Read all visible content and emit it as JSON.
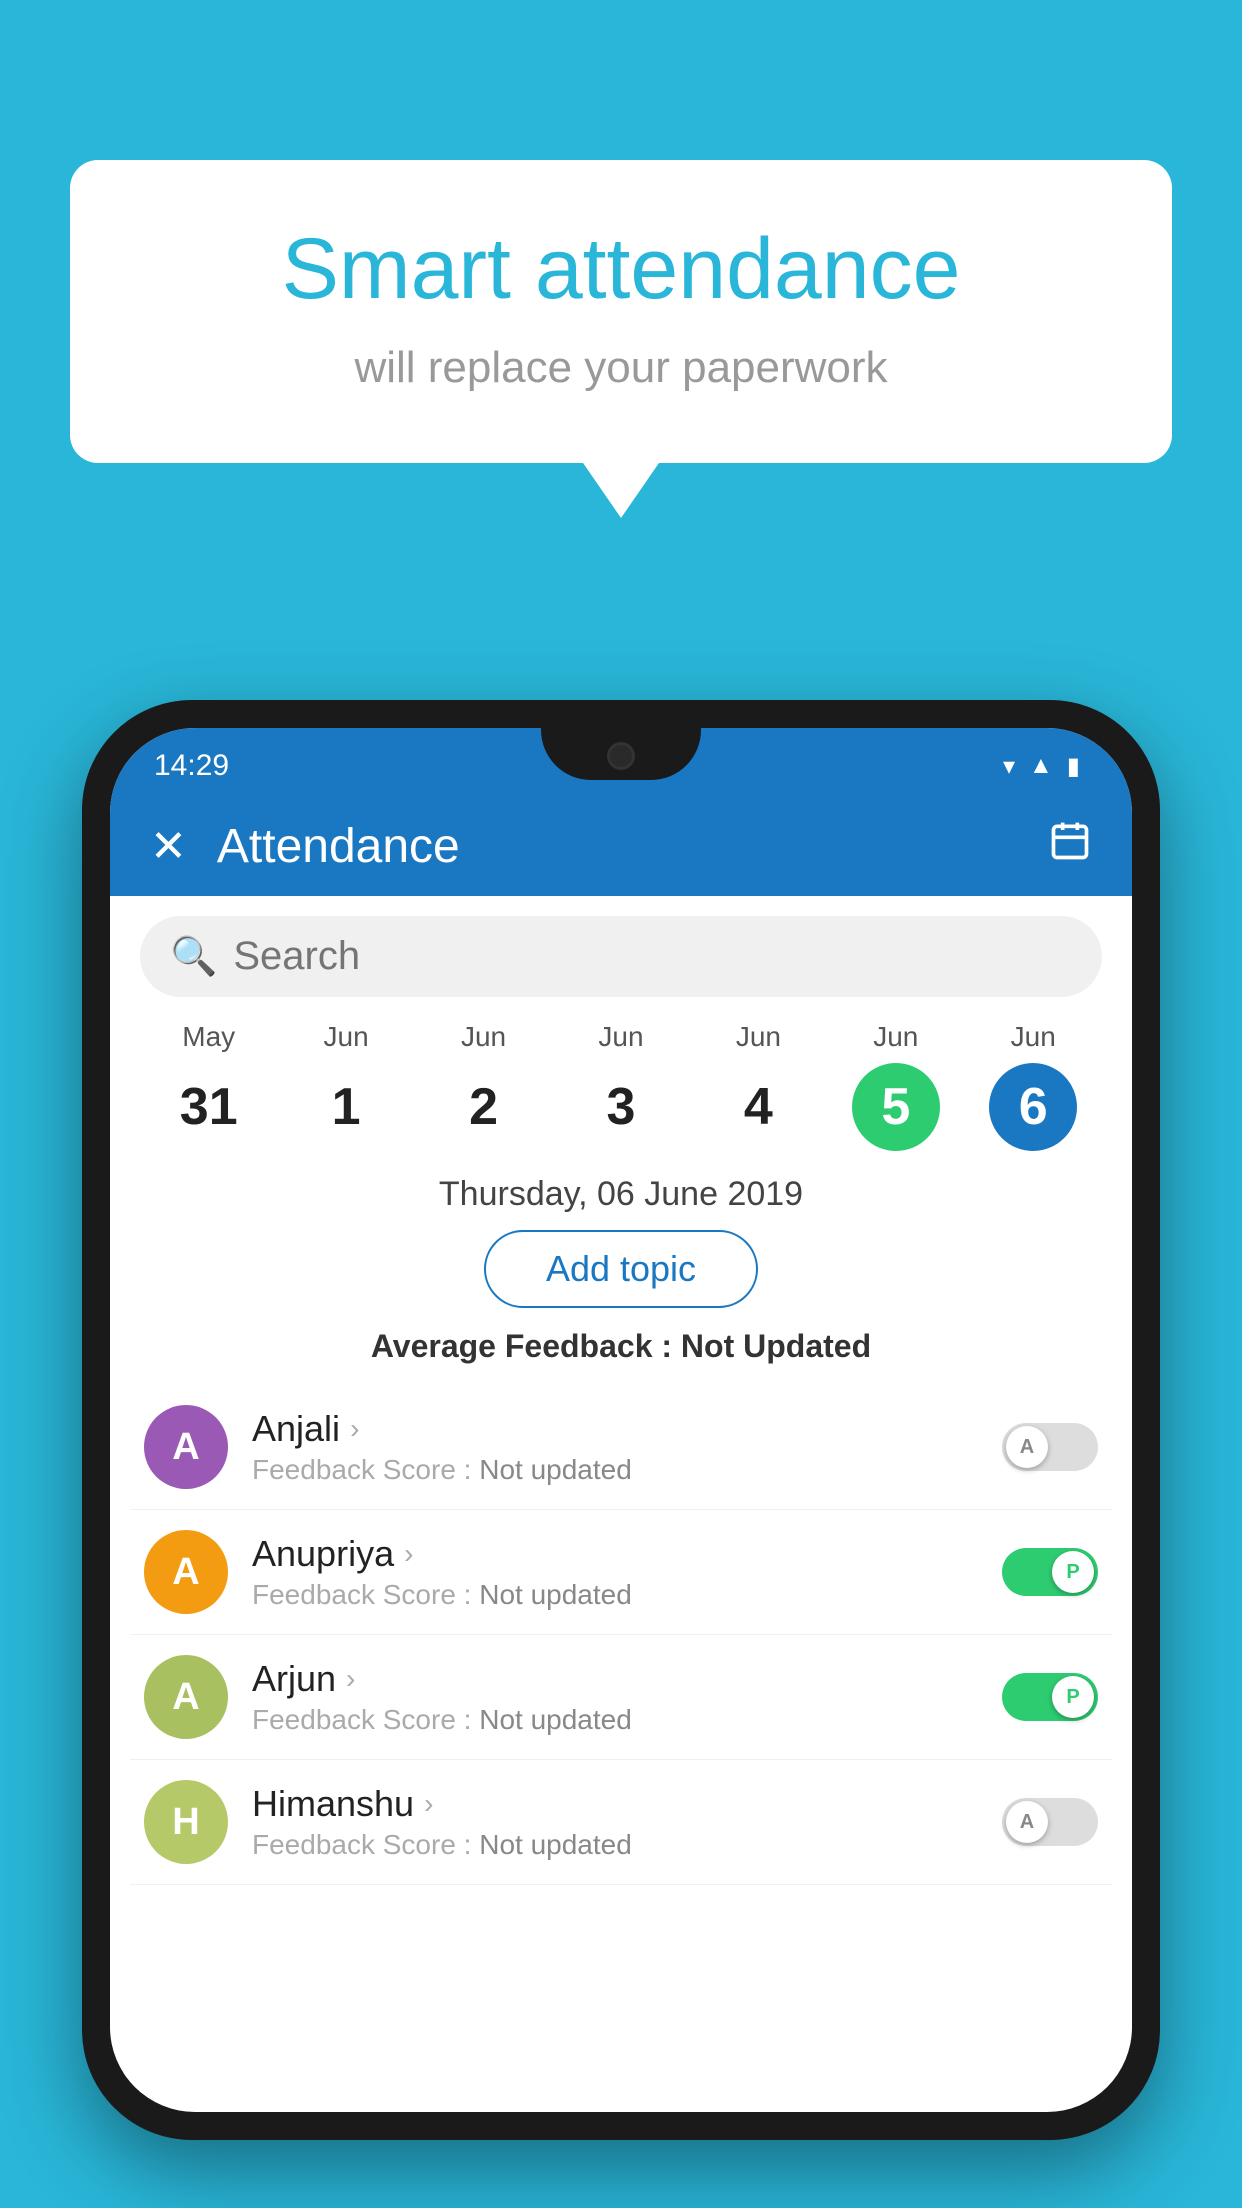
{
  "background_color": "#29b6d8",
  "speech_bubble": {
    "title": "Smart attendance",
    "subtitle": "will replace your paperwork"
  },
  "status_bar": {
    "time": "14:29",
    "icons": [
      "wifi",
      "signal",
      "battery"
    ]
  },
  "header": {
    "title": "Attendance",
    "close_label": "✕",
    "calendar_label": "📅"
  },
  "search": {
    "placeholder": "Search"
  },
  "dates": [
    {
      "month": "May",
      "day": "31",
      "style": "normal"
    },
    {
      "month": "Jun",
      "day": "1",
      "style": "normal"
    },
    {
      "month": "Jun",
      "day": "2",
      "style": "normal"
    },
    {
      "month": "Jun",
      "day": "3",
      "style": "normal"
    },
    {
      "month": "Jun",
      "day": "4",
      "style": "normal"
    },
    {
      "month": "Jun",
      "day": "5",
      "style": "today-green"
    },
    {
      "month": "Jun",
      "day": "6",
      "style": "selected-blue"
    }
  ],
  "selected_date": "Thursday, 06 June 2019",
  "add_topic_label": "Add topic",
  "avg_feedback": {
    "label": "Average Feedback : ",
    "value": "Not Updated"
  },
  "students": [
    {
      "name": "Anjali",
      "initial": "A",
      "avatar_color": "#9b59b6",
      "feedback_label": "Feedback Score : ",
      "feedback_value": "Not updated",
      "attendance": "A",
      "present": false
    },
    {
      "name": "Anupriya",
      "initial": "A",
      "avatar_color": "#f39c12",
      "feedback_label": "Feedback Score : ",
      "feedback_value": "Not updated",
      "attendance": "P",
      "present": true
    },
    {
      "name": "Arjun",
      "initial": "A",
      "avatar_color": "#a8c060",
      "feedback_label": "Feedback Score : ",
      "feedback_value": "Not updated",
      "attendance": "P",
      "present": true
    },
    {
      "name": "Himanshu",
      "initial": "H",
      "avatar_color": "#b5c968",
      "feedback_label": "Feedback Score : ",
      "feedback_value": "Not updated",
      "attendance": "A",
      "present": false
    }
  ]
}
